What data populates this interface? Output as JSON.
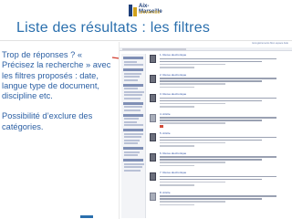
{
  "logo": {
    "name": "Aix-Marseille",
    "sub": "université",
    "colors": {
      "primary": "#1e3f7a",
      "accent": "#d1a21c"
    }
  },
  "slide": {
    "title": "Liste des résultats : les filtres",
    "paragraph1": "Trop de réponses ? « Précisez la recherche » avec les filtres proposés : date, langue type de document, discipline etc.",
    "paragraph2": "Possibilité d’exclure des catégories.",
    "title_color": "#2a6fad",
    "text_color": "#2b5fa3"
  },
  "screenshot": {
    "top_nav": "Enregistrements  Mon espace  Aide",
    "results": [
      {
        "title": "1. Revue électronique",
        "thumb": "dark",
        "badge": false
      },
      {
        "title": "2. Revue électronique",
        "thumb": "dark",
        "badge": false
      },
      {
        "title": "3. Revue électronique",
        "thumb": "dark",
        "badge": false
      },
      {
        "title": "4. Article",
        "thumb": "light",
        "badge": true
      },
      {
        "title": "5. Article",
        "thumb": "dark",
        "badge": false
      },
      {
        "title": "6. Revue électronique",
        "thumb": "dark",
        "badge": false
      },
      {
        "title": "7. Revue électronique",
        "thumb": "dark",
        "badge": false
      },
      {
        "title": "8. Article",
        "thumb": "light",
        "badge": false
      }
    ],
    "facet_groups": 8
  }
}
